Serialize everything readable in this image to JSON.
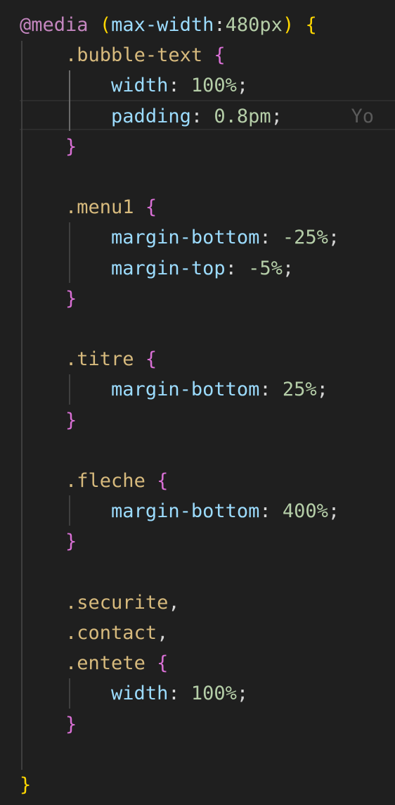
{
  "editor": {
    "lines": [
      {
        "tokens": [
          {
            "t": "@media",
            "c": "t-at"
          },
          {
            "t": " ",
            "c": "t-punc"
          },
          {
            "t": "(",
            "c": "t-paren"
          },
          {
            "t": "max-width",
            "c": "t-feat"
          },
          {
            "t": ":",
            "c": "t-punc"
          },
          {
            "t": "480px",
            "c": "t-num"
          },
          {
            "t": ")",
            "c": "t-paren"
          },
          {
            "t": " ",
            "c": "t-punc"
          },
          {
            "t": "{",
            "c": "t-brace-y"
          }
        ]
      },
      {
        "tokens": [
          {
            "t": "    ",
            "c": "t-punc"
          },
          {
            "t": ".bubble-text",
            "c": "t-sel"
          },
          {
            "t": " ",
            "c": "t-punc"
          },
          {
            "t": "{",
            "c": "t-brace-p"
          }
        ]
      },
      {
        "tokens": [
          {
            "t": "        ",
            "c": "t-punc"
          },
          {
            "t": "width",
            "c": "t-prop"
          },
          {
            "t": ": ",
            "c": "t-punc"
          },
          {
            "t": "100%",
            "c": "t-num"
          },
          {
            "t": ";",
            "c": "t-punc"
          }
        ]
      },
      {
        "tokens": [
          {
            "t": "        ",
            "c": "t-punc"
          },
          {
            "t": "padding",
            "c": "t-prop"
          },
          {
            "t": ": ",
            "c": "t-punc"
          },
          {
            "t": "0.8pm",
            "c": "t-num"
          },
          {
            "t": ";",
            "c": "t-punc"
          },
          {
            "t": "      Yo",
            "c": "t-ghost"
          }
        ]
      },
      {
        "tokens": [
          {
            "t": "    ",
            "c": "t-punc"
          },
          {
            "t": "}",
            "c": "t-brace-p"
          }
        ]
      },
      {
        "tokens": []
      },
      {
        "tokens": [
          {
            "t": "    ",
            "c": "t-punc"
          },
          {
            "t": ".menu1",
            "c": "t-sel"
          },
          {
            "t": " ",
            "c": "t-punc"
          },
          {
            "t": "{",
            "c": "t-brace-p"
          }
        ]
      },
      {
        "tokens": [
          {
            "t": "        ",
            "c": "t-punc"
          },
          {
            "t": "margin-bottom",
            "c": "t-prop"
          },
          {
            "t": ": ",
            "c": "t-punc"
          },
          {
            "t": "-25%",
            "c": "t-num"
          },
          {
            "t": ";",
            "c": "t-punc"
          }
        ]
      },
      {
        "tokens": [
          {
            "t": "        ",
            "c": "t-punc"
          },
          {
            "t": "margin-top",
            "c": "t-prop"
          },
          {
            "t": ": ",
            "c": "t-punc"
          },
          {
            "t": "-5%",
            "c": "t-num"
          },
          {
            "t": ";",
            "c": "t-punc"
          }
        ]
      },
      {
        "tokens": [
          {
            "t": "    ",
            "c": "t-punc"
          },
          {
            "t": "}",
            "c": "t-brace-p"
          }
        ]
      },
      {
        "tokens": []
      },
      {
        "tokens": [
          {
            "t": "    ",
            "c": "t-punc"
          },
          {
            "t": ".titre",
            "c": "t-sel"
          },
          {
            "t": " ",
            "c": "t-punc"
          },
          {
            "t": "{",
            "c": "t-brace-p"
          }
        ]
      },
      {
        "tokens": [
          {
            "t": "        ",
            "c": "t-punc"
          },
          {
            "t": "margin-bottom",
            "c": "t-prop"
          },
          {
            "t": ": ",
            "c": "t-punc"
          },
          {
            "t": "25%",
            "c": "t-num"
          },
          {
            "t": ";",
            "c": "t-punc"
          }
        ]
      },
      {
        "tokens": [
          {
            "t": "    ",
            "c": "t-punc"
          },
          {
            "t": "}",
            "c": "t-brace-p"
          }
        ]
      },
      {
        "tokens": []
      },
      {
        "tokens": [
          {
            "t": "    ",
            "c": "t-punc"
          },
          {
            "t": ".fleche",
            "c": "t-sel"
          },
          {
            "t": " ",
            "c": "t-punc"
          },
          {
            "t": "{",
            "c": "t-brace-p"
          }
        ]
      },
      {
        "tokens": [
          {
            "t": "        ",
            "c": "t-punc"
          },
          {
            "t": "margin-bottom",
            "c": "t-prop"
          },
          {
            "t": ": ",
            "c": "t-punc"
          },
          {
            "t": "400%",
            "c": "t-num"
          },
          {
            "t": ";",
            "c": "t-punc"
          }
        ]
      },
      {
        "tokens": [
          {
            "t": "    ",
            "c": "t-punc"
          },
          {
            "t": "}",
            "c": "t-brace-p"
          }
        ]
      },
      {
        "tokens": []
      },
      {
        "tokens": [
          {
            "t": "    ",
            "c": "t-punc"
          },
          {
            "t": ".securite",
            "c": "t-sel"
          },
          {
            "t": ",",
            "c": "t-punc"
          }
        ]
      },
      {
        "tokens": [
          {
            "t": "    ",
            "c": "t-punc"
          },
          {
            "t": ".contact",
            "c": "t-sel"
          },
          {
            "t": ",",
            "c": "t-punc"
          }
        ]
      },
      {
        "tokens": [
          {
            "t": "    ",
            "c": "t-punc"
          },
          {
            "t": ".entete",
            "c": "t-sel"
          },
          {
            "t": " ",
            "c": "t-punc"
          },
          {
            "t": "{",
            "c": "t-brace-p"
          }
        ]
      },
      {
        "tokens": [
          {
            "t": "        ",
            "c": "t-punc"
          },
          {
            "t": "width",
            "c": "t-prop"
          },
          {
            "t": ": ",
            "c": "t-punc"
          },
          {
            "t": "100%",
            "c": "t-num"
          },
          {
            "t": ";",
            "c": "t-punc"
          }
        ]
      },
      {
        "tokens": [
          {
            "t": "    ",
            "c": "t-punc"
          },
          {
            "t": "}",
            "c": "t-brace-p"
          }
        ]
      },
      {
        "tokens": []
      },
      {
        "tokens": [
          {
            "t": "}",
            "c": "t-brace-y"
          }
        ]
      }
    ]
  },
  "colors": {
    "background": "#1f1f1f",
    "at_rule": "#c586c0",
    "media_feature": "#9cdcfe",
    "number": "#b5cea8",
    "selector": "#d7ba7d",
    "property": "#9cdcfe",
    "brace_level1": "#ffd700",
    "brace_level2": "#da70d6",
    "ghost_text": "#5a5a5a"
  }
}
